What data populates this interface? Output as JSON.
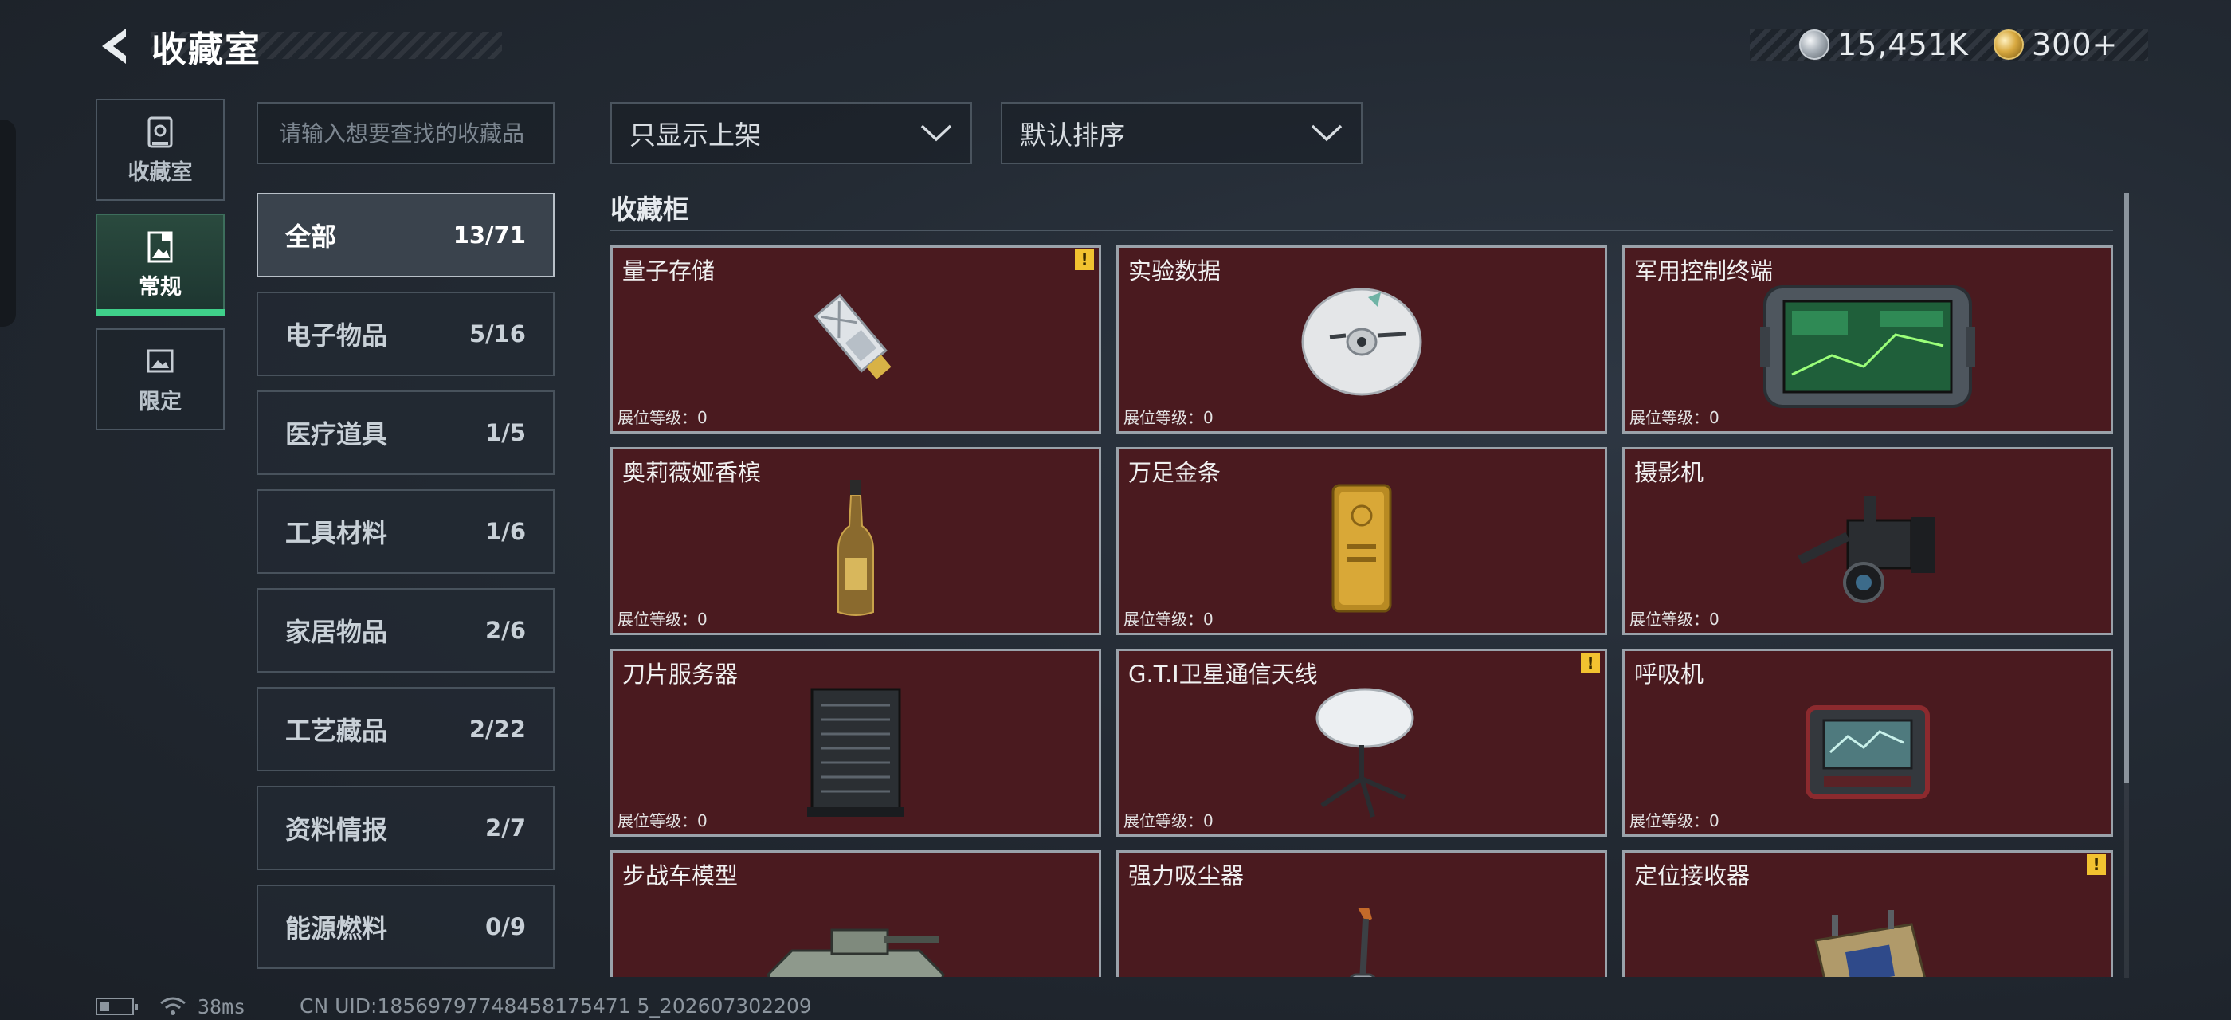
{
  "header": {
    "title": "收藏室",
    "currencies": [
      {
        "icon": "silver-coin-icon",
        "value": "15,451K"
      },
      {
        "icon": "gold-coin-icon",
        "value": "300+"
      }
    ]
  },
  "nav": [
    {
      "label": "收藏室",
      "icon": "vault-icon",
      "active": false
    },
    {
      "label": "常规",
      "icon": "portrait-frame-icon",
      "active": true
    },
    {
      "label": "限定",
      "icon": "landscape-frame-icon",
      "active": false
    }
  ],
  "search": {
    "placeholder": "请输入想要查找的收藏品"
  },
  "filters": {
    "display_filter": "只显示上架",
    "sort": "默认排序"
  },
  "categories": [
    {
      "name": "全部",
      "count": "13/71",
      "active": true
    },
    {
      "name": "电子物品",
      "count": "5/16"
    },
    {
      "name": "医疗道具",
      "count": "1/5"
    },
    {
      "name": "工具材料",
      "count": "1/6"
    },
    {
      "name": "家居物品",
      "count": "2/6"
    },
    {
      "name": "工艺藏品",
      "count": "2/22"
    },
    {
      "name": "资料情报",
      "count": "2/7"
    },
    {
      "name": "能源燃料",
      "count": "0/9"
    }
  ],
  "cabinet": {
    "title": "收藏柜",
    "level_label": "展位等级：",
    "items": [
      {
        "name": "量子存储",
        "level": "0",
        "warning": true,
        "icon": "usb-drive-icon"
      },
      {
        "name": "实验数据",
        "level": "0",
        "warning": false,
        "icon": "disc-icon"
      },
      {
        "name": "军用控制终端",
        "level": "0",
        "warning": false,
        "icon": "rugged-tablet-icon"
      },
      {
        "name": "奥莉薇娅香槟",
        "level": "0",
        "warning": false,
        "icon": "champagne-bottle-icon"
      },
      {
        "name": "万足金条",
        "level": "0",
        "warning": false,
        "icon": "gold-bar-icon"
      },
      {
        "name": "摄影机",
        "level": "0",
        "warning": false,
        "icon": "video-camera-icon"
      },
      {
        "name": "刀片服务器",
        "level": "0",
        "warning": false,
        "icon": "server-icon"
      },
      {
        "name": "G.T.I卫星通信天线",
        "level": "0",
        "warning": true,
        "icon": "satellite-dish-icon"
      },
      {
        "name": "呼吸机",
        "level": "0",
        "warning": false,
        "icon": "ventilator-icon"
      },
      {
        "name": "步战车模型",
        "level": "",
        "warning": false,
        "icon": "ifv-model-icon"
      },
      {
        "name": "强力吸尘器",
        "level": "",
        "warning": false,
        "icon": "vacuum-icon"
      },
      {
        "name": "定位接收器",
        "level": "",
        "warning": true,
        "icon": "gps-receiver-icon"
      }
    ]
  },
  "footer": {
    "ping": "38ms",
    "uid": "CN UID:18569797748458175471 5_202607302209"
  },
  "colors": {
    "accent_green": "#3fd08a",
    "card_bg": "#4a1a1f",
    "warning": "#f2c230"
  }
}
